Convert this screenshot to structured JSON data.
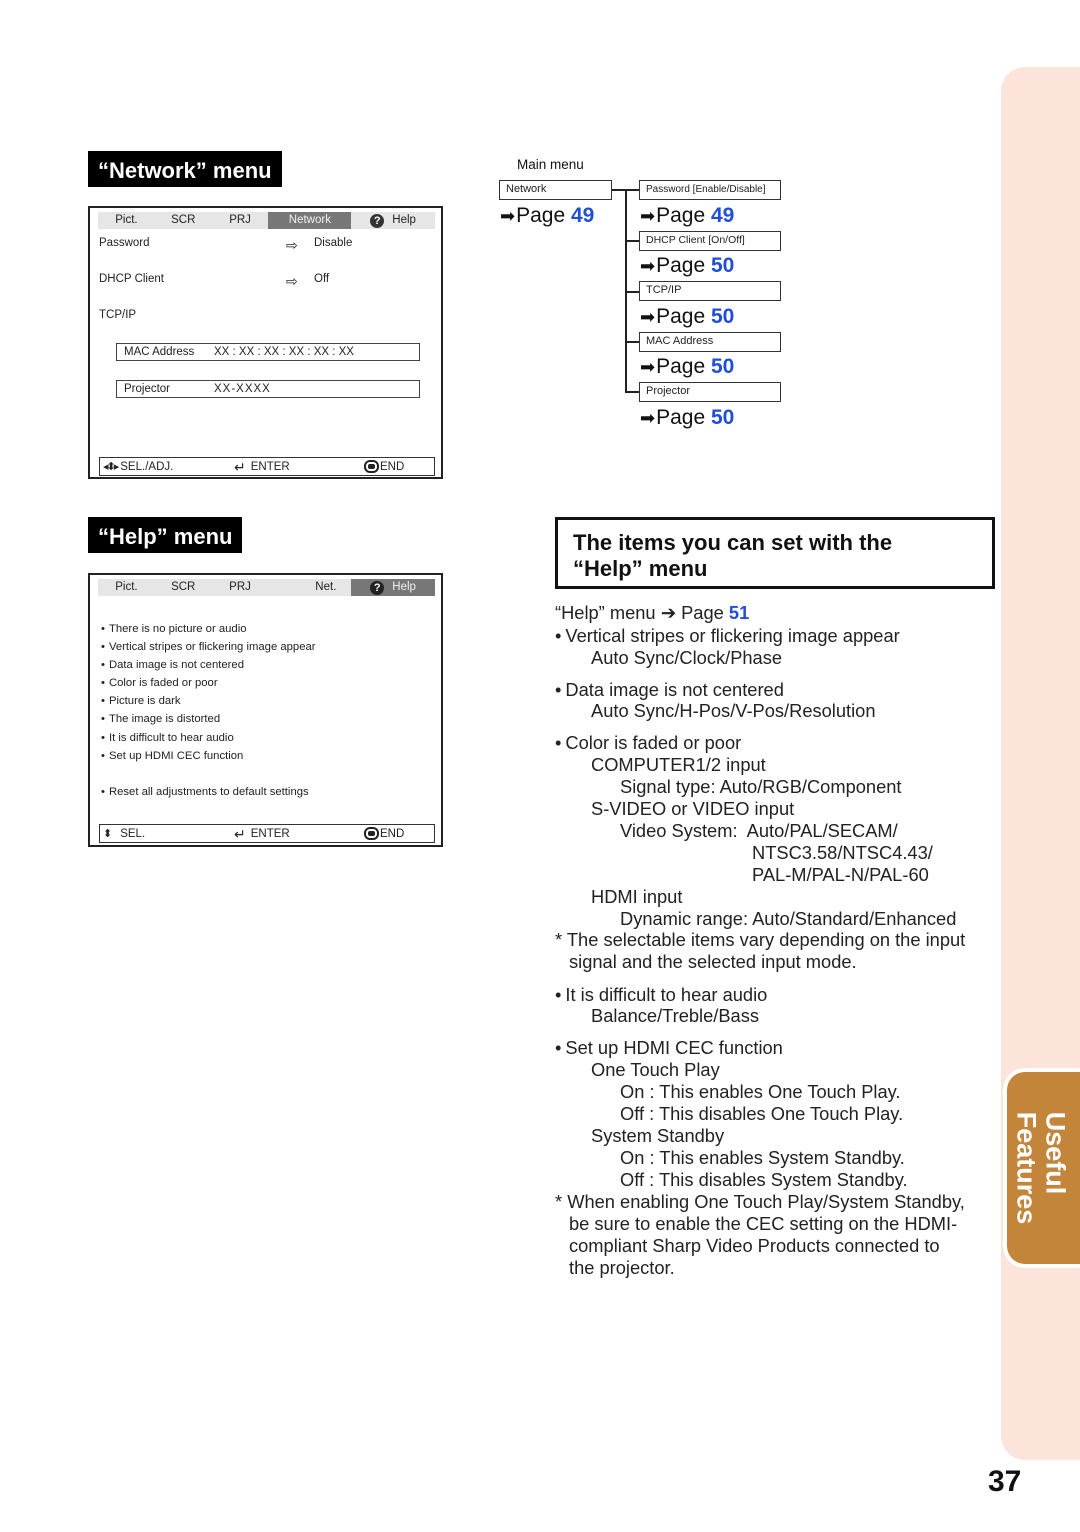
{
  "side_tab": {
    "label_line1": "Useful",
    "label_line2": "Features",
    "accent_color": "#c3853a",
    "strip_color": "#fde4da"
  },
  "page_number": "37",
  "network_section": {
    "title": "“Network” menu",
    "osd": {
      "tabs": [
        "Pict.",
        "SCR",
        "PRJ",
        "Network",
        "Help"
      ],
      "active_tab": "Network",
      "rows": [
        {
          "label": "Password",
          "arrow_icon": "hollow-right-arrow-icon",
          "value": "Disable"
        },
        {
          "label": "DHCP Client",
          "arrow_icon": "hollow-right-arrow-icon",
          "value": "Off"
        },
        {
          "label": "TCP/IP"
        }
      ],
      "mac_label": "MAC Address",
      "mac_value": "XX : XX : XX : XX : XX : XX",
      "projector_label": "Projector",
      "projector_value": "XX-XXXX",
      "footer": {
        "sel": "SEL./ADJ.",
        "enter": "ENTER",
        "end": "END"
      }
    }
  },
  "tree": {
    "main_menu_label": "Main menu",
    "root": {
      "label": "Network",
      "page_prefix": "Page",
      "page": "49"
    },
    "children": [
      {
        "label": "Password [Enable/Disable]",
        "page_prefix": "Page",
        "page": "49"
      },
      {
        "label": "DHCP Client [On/Off]",
        "page_prefix": "Page",
        "page": "50"
      },
      {
        "label": "TCP/IP",
        "page_prefix": "Page",
        "page": "50"
      },
      {
        "label": "MAC Address",
        "page_prefix": "Page",
        "page": "50"
      },
      {
        "label": "Projector",
        "page_prefix": "Page",
        "page": "50"
      }
    ],
    "link_color": "#1f4ed8"
  },
  "help_section": {
    "title": "“Help” menu",
    "osd": {
      "tabs": [
        "Pict.",
        "SCR",
        "PRJ",
        "Net.",
        "Help"
      ],
      "active_tab": "Help",
      "items": [
        "There is no picture or audio",
        "Vertical stripes or flickering image appear",
        "Data image is not centered",
        "Color is faded or poor",
        "Picture is dark",
        "The image is distorted",
        "It is difficult to hear audio",
        "Set up HDMI CEC function"
      ],
      "reset_item": "Reset all adjustments to default settings",
      "footer": {
        "sel": "SEL.",
        "enter": "ENTER",
        "end": "END"
      }
    }
  },
  "items_section": {
    "heading_line1": "The items you can set with the",
    "heading_line2": "“Help” menu",
    "ref": {
      "text": "“Help” menu",
      "arrow": "➔",
      "page_prefix": "Page",
      "page": "51"
    },
    "lines": {
      "b1": "Vertical stripes or flickering image appear",
      "b1_1": "Auto Sync/Clock/Phase",
      "b2": "Data image is not centered",
      "b2_1": "Auto Sync/H-Pos/V-Pos/Resolution",
      "b3": "Color is faded or poor",
      "b3_1": "COMPUTER1/2 input",
      "b3_1a": "Signal type: Auto/RGB/Component",
      "b3_2": "S-VIDEO or VIDEO input",
      "b3_2a": "Video System:  Auto/PAL/SECAM/",
      "b3_2b": "NTSC3.58/NTSC4.43/",
      "b3_2c": "PAL-M/PAL-N/PAL-60",
      "b3_3": "HDMI input",
      "b3_3a": "Dynamic range: Auto/Standard/Enhanced",
      "note1_l1": "* The selectable items vary depending on the input",
      "note1_l2": "signal and the selected input mode.",
      "b4": "It is difficult to hear audio",
      "b4_1": "Balance/Treble/Bass",
      "b5": "Set up HDMI CEC function",
      "b5_1": "One Touch Play",
      "b5_1a": "On : This enables One Touch Play.",
      "b5_1b": "Off : This disables One Touch Play.",
      "b5_2": "System Standby",
      "b5_2a": "On : This enables System Standby.",
      "b5_2b": "Off : This disables System Standby.",
      "note2_l1": "* When enabling One Touch Play/System Standby,",
      "note2_l2": "be sure to enable the CEC setting on the HDMI-",
      "note2_l3": "compliant Sharp Video Products connected to",
      "note2_l4": "the projector."
    }
  }
}
